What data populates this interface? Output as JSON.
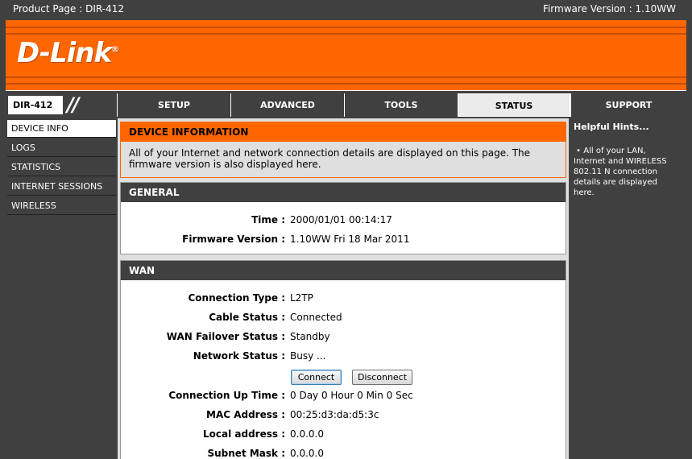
{
  "topbar": {
    "product": "Product Page : DIR-412",
    "firmware": "Firmware Version : 1.10WW"
  },
  "brand": {
    "logo": "D-Link",
    "reg": "®"
  },
  "model": {
    "name": "DIR-412",
    "slashes": "//"
  },
  "tabs": [
    "SETUP",
    "ADVANCED",
    "TOOLS",
    "STATUS",
    "SUPPORT"
  ],
  "active_tab": "STATUS",
  "sidebar": {
    "items": [
      {
        "label": "DEVICE INFO"
      },
      {
        "label": "LOGS"
      },
      {
        "label": "STATISTICS"
      },
      {
        "label": "INTERNET SESSIONS"
      },
      {
        "label": "WIRELESS"
      }
    ]
  },
  "device_info": {
    "title": "DEVICE INFORMATION",
    "description": "All of your Internet and network connection details are displayed on this page. The firmware version is also displayed here."
  },
  "general": {
    "title": "GENERAL",
    "time_label": "Time :",
    "time_value": "2000/01/01 00:14:17",
    "fw_label": "Firmware Version :",
    "fw_value": "1.10WW Fri 18 Mar 2011"
  },
  "wan": {
    "title": "WAN",
    "conn_type_label": "Connection Type :",
    "conn_type_value": "L2TP",
    "cable_label": "Cable Status :",
    "cable_value": "Connected",
    "failover_label": "WAN Failover Status :",
    "failover_value": "Standby",
    "network_label": "Network Status :",
    "network_value": "Busy ...",
    "connect_button": "Connect",
    "disconnect_button": "Disconnect",
    "uptime_label": "Connection Up Time :",
    "uptime_value": "0 Day 0 Hour 0 Min 0 Sec",
    "mac_label": "MAC Address :",
    "mac_value": "00:25:d3:da:d5:3c",
    "local_label": "Local address :",
    "local_value": "0.0.0.0",
    "subnet_label": "Subnet Mask :",
    "subnet_value": "0.0.0.0"
  },
  "hints": {
    "title": "Helpful Hints...",
    "text": "All of your LAN, Internet and WIRELESS 802.11 N connection details are displayed here."
  },
  "colors": {
    "accent": "#ff6600",
    "dark": "#404040",
    "panel": "#dfdfdf"
  }
}
